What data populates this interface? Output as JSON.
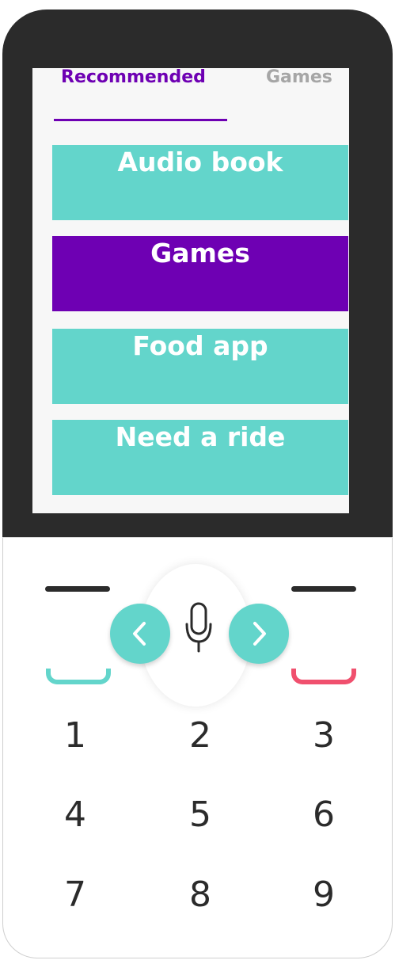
{
  "tabs": [
    {
      "label": "Recommended",
      "active": true
    },
    {
      "label": "Games",
      "active": false
    }
  ],
  "menu": {
    "items": [
      {
        "label": "Audio book",
        "selected": false
      },
      {
        "label": "Games",
        "selected": true
      },
      {
        "label": "Food app",
        "selected": false
      },
      {
        "label": "Need a ride",
        "selected": false
      }
    ]
  },
  "keypad": {
    "keys": [
      "1",
      "2",
      "3",
      "4",
      "5",
      "6",
      "7",
      "8",
      "9"
    ]
  },
  "icons": {
    "nav_left": "chevron-left-icon",
    "nav_right": "chevron-right-icon",
    "mic": "microphone-icon",
    "call": "call-key-icon",
    "end_call": "end-call-key-icon"
  },
  "colors": {
    "accent_purple": "#6e00b3",
    "teal": "#63d5cb",
    "end_call_red": "#f0506e",
    "phone_body": "#2b2b2b",
    "inactive_tab": "#a6a6a6"
  }
}
